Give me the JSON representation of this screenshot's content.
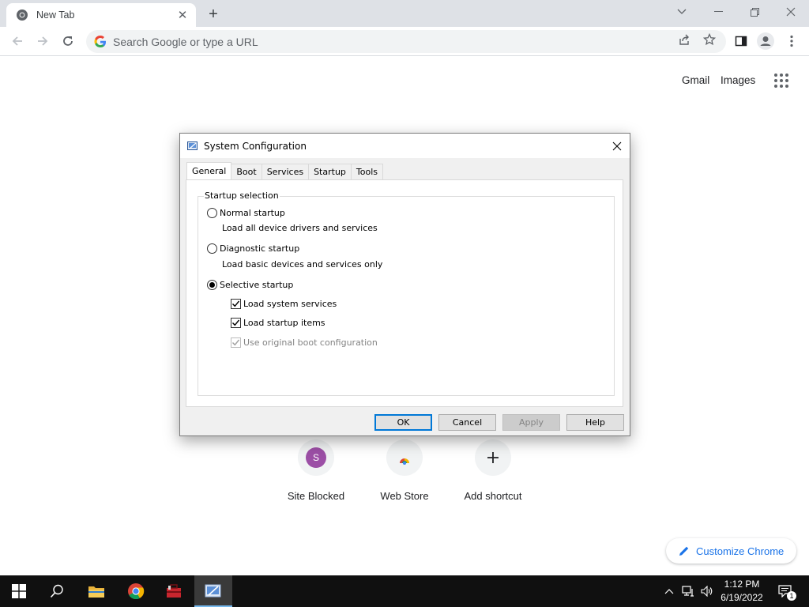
{
  "browser": {
    "tab_title": "New Tab",
    "omnibox_placeholder": "Search Google or type a URL"
  },
  "ntp": {
    "gmail_link": "Gmail",
    "images_link": "Images",
    "shortcuts": [
      {
        "label": "Site Blocked",
        "initial": "S",
        "color": "#9c4fa6"
      },
      {
        "label": "Web Store"
      },
      {
        "label": "Add shortcut"
      }
    ],
    "customize_label": "Customize Chrome"
  },
  "dialog": {
    "title": "System Configuration",
    "tabs": [
      "General",
      "Boot",
      "Services",
      "Startup",
      "Tools"
    ],
    "active_tab": "General",
    "group_label": "Startup selection",
    "options": [
      {
        "label": "Normal startup",
        "desc": "Load all device drivers and services",
        "selected": false
      },
      {
        "label": "Diagnostic startup",
        "desc": "Load basic devices and services only",
        "selected": false
      },
      {
        "label": "Selective startup",
        "selected": true
      }
    ],
    "checkboxes": [
      {
        "label": "Load system services",
        "checked": true,
        "enabled": true
      },
      {
        "label": "Load startup items",
        "checked": true,
        "enabled": true
      },
      {
        "label": "Use original boot configuration",
        "checked": true,
        "enabled": false
      }
    ],
    "buttons": {
      "ok": "OK",
      "cancel": "Cancel",
      "apply": "Apply",
      "help": "Help"
    }
  },
  "taskbar": {
    "time": "1:12 PM",
    "date": "6/19/2022",
    "notification_count": "1"
  },
  "colors": {
    "accent": "#1a73e8",
    "taskbar": "#101010",
    "dialog_default_border": "#0078d7"
  }
}
